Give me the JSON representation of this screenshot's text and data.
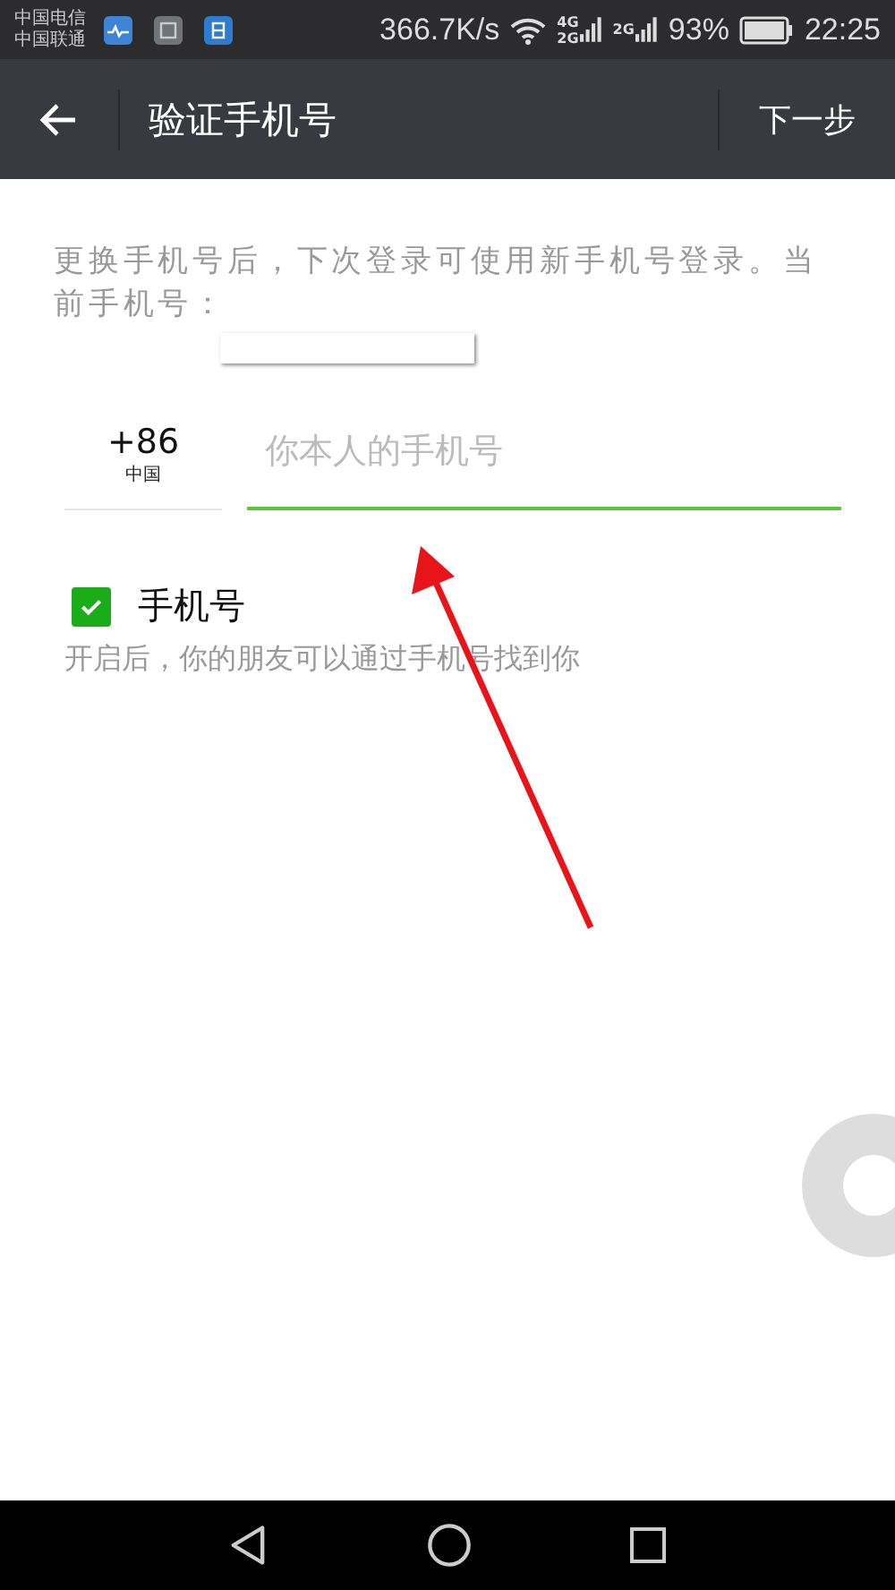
{
  "status_bar": {
    "carriers": [
      "中国电信",
      "中国联通"
    ],
    "speed": "366.7K/s",
    "network_labels": [
      {
        "top": "4G",
        "bottom": "2G"
      },
      {
        "top": "2G"
      }
    ],
    "battery": "93%",
    "time": "22:25"
  },
  "toolbar": {
    "title": "验证手机号",
    "action": "下一步"
  },
  "notice": {
    "text": "更换手机号后，下次登录可使用新手机号登录。当前手机号："
  },
  "phone": {
    "country_code": "+86",
    "country": "中国",
    "placeholder": "你本人的手机号"
  },
  "option": {
    "label": "手机号",
    "checked": true,
    "description": "开启后，你的朋友可以通过手机号找到你"
  }
}
